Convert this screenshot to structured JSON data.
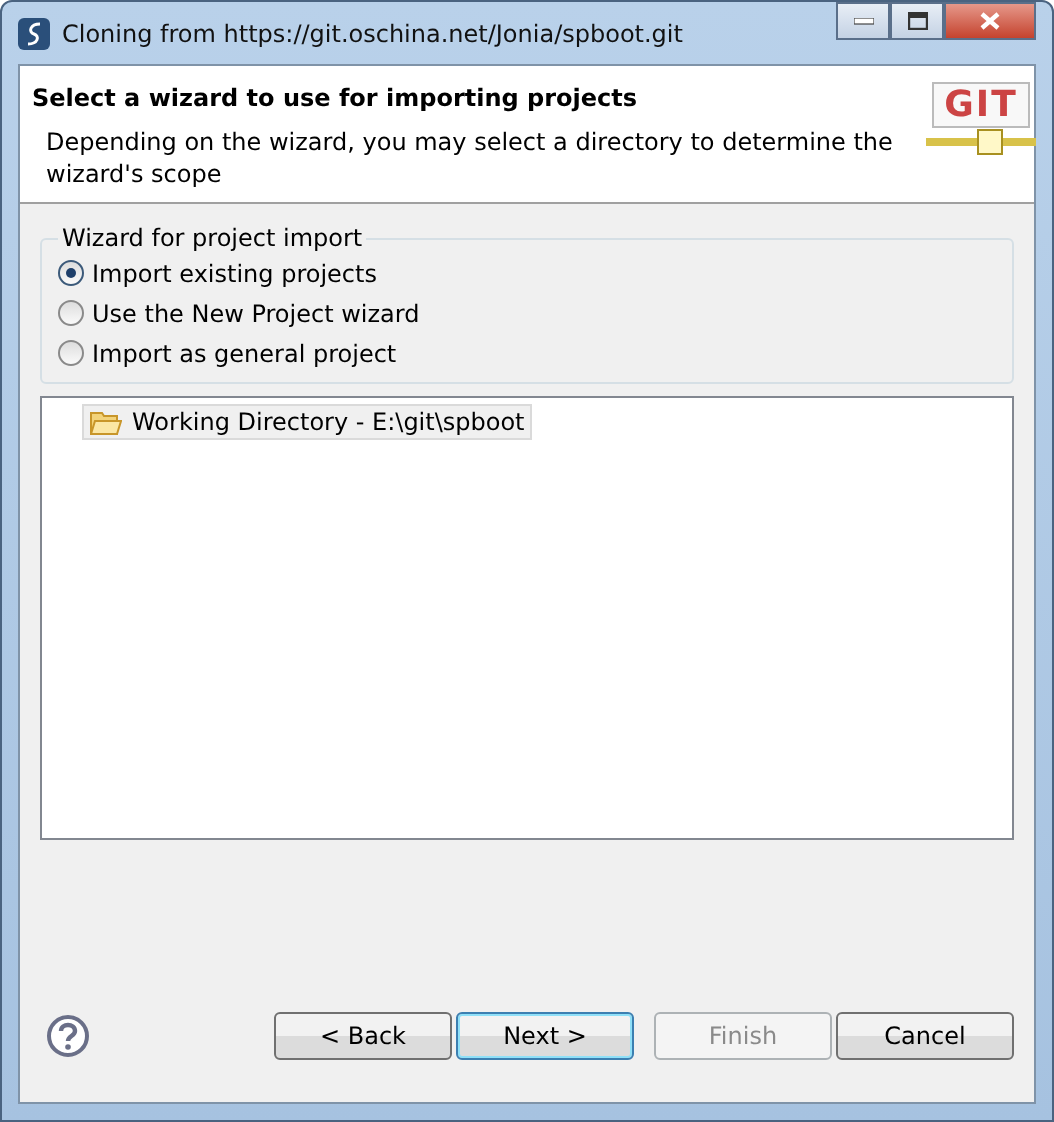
{
  "window": {
    "title": "Cloning from https://git.oschina.net/Jonia/spboot.git"
  },
  "header": {
    "title": "Select a wizard to use for importing projects",
    "description": "Depending on the wizard, you may select a directory to determine the wizard's scope",
    "logo": "GIT"
  },
  "wizard_group": {
    "title": "Wizard for project import",
    "options": [
      {
        "label": "Import existing projects",
        "selected": true
      },
      {
        "label": "Use the New Project wizard",
        "selected": false
      },
      {
        "label": "Import as general project",
        "selected": false
      }
    ]
  },
  "tree": {
    "items": [
      {
        "label": "Working Directory - E:\\git\\spboot",
        "selected": true
      }
    ]
  },
  "buttons": [
    {
      "label": "< Back",
      "disabled": false,
      "default": false
    },
    {
      "label": "Next >",
      "disabled": false,
      "default": true
    },
    {
      "label": "Finish",
      "disabled": true,
      "default": false
    },
    {
      "label": "Cancel",
      "disabled": false,
      "default": false
    }
  ]
}
